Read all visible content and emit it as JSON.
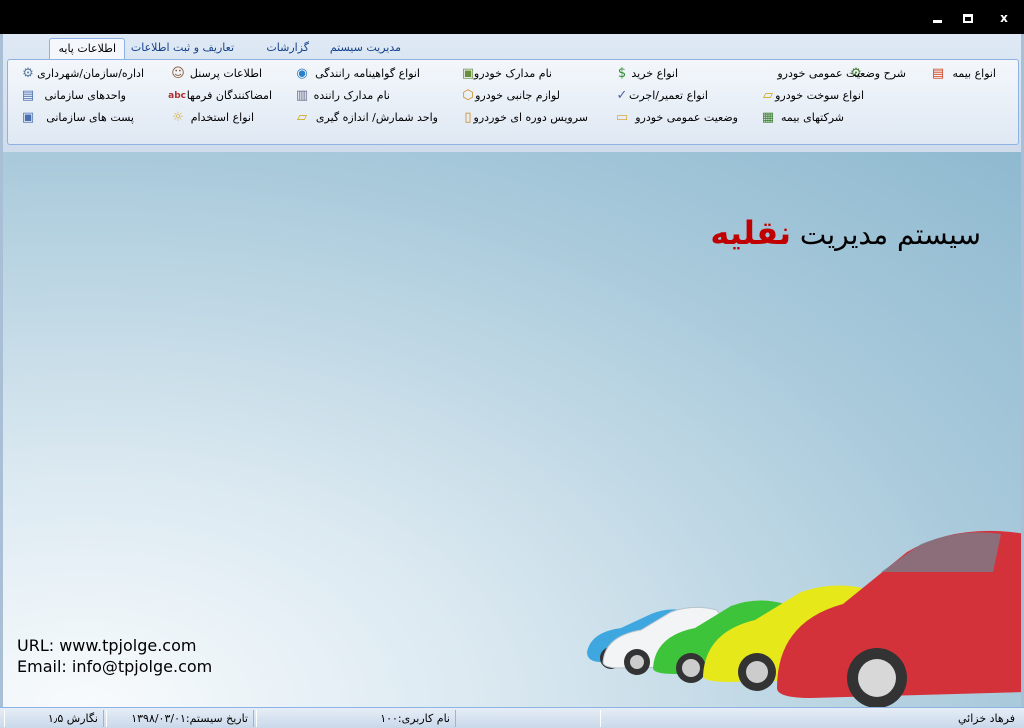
{
  "window": {
    "min_label": "_",
    "max_label": "□",
    "close_label": "x"
  },
  "tabs": [
    {
      "label": "اطلاعات پایه",
      "active": true
    },
    {
      "label": "تعاریف و ثبت اطلاعات",
      "active": false
    },
    {
      "label": "گزارشات",
      "active": false
    },
    {
      "label": "مدیریت سیستم",
      "active": false
    }
  ],
  "ribbon": {
    "col1": [
      {
        "label": "انواع بیمه",
        "icon": "insurance-type-icon"
      },
      {
        "label": "شرح وضعیت عمومی خودرو",
        "icon": "vehicle-status-description-icon"
      },
      {
        "label": "انواع سوخت خودرو",
        "icon": "fuel-type-icon"
      },
      {
        "label": "شرکتهای بیمه",
        "icon": "insurance-company-icon"
      }
    ],
    "col2": [
      {
        "label": "انواع خرید",
        "icon": "purchase-type-icon"
      },
      {
        "label": "انواع تعمیر/اجرت",
        "icon": "repair-type-icon"
      },
      {
        "label": "وضعیت عمومی خودرو",
        "icon": "vehicle-status-icon"
      }
    ],
    "col3": [
      {
        "label": "نام مدارک خودرو",
        "icon": "vehicle-documents-icon"
      },
      {
        "label": "لوازم جانبی خودرو",
        "icon": "vehicle-accessories-icon"
      },
      {
        "label": "سرویس دوره ای خوردرو",
        "icon": "periodic-service-icon"
      }
    ],
    "col4": [
      {
        "label": "انواع گواهینامه رانندگی",
        "icon": "license-type-icon"
      },
      {
        "label": "نام مدارک راننده",
        "icon": "driver-documents-icon"
      },
      {
        "label": "واحد شمارش/ اندازه گیری",
        "icon": "measurement-unit-icon"
      }
    ],
    "col5": [
      {
        "label": "اطلاعات پرسنل",
        "icon": "personnel-icon"
      },
      {
        "label": "امضاکنندگان فرمها",
        "icon": "form-signers-icon"
      },
      {
        "label": "انواع استخدام",
        "icon": "employment-type-icon"
      }
    ],
    "col6": [
      {
        "label": "اداره/سازمان/شهرداری",
        "icon": "organization-icon"
      },
      {
        "label": "واحدهای سازمانی",
        "icon": "org-units-icon"
      },
      {
        "label": "پست های سازمانی",
        "icon": "org-posts-icon"
      }
    ]
  },
  "main": {
    "title_prefix": "سیستم مدیریت",
    "title_accent": "نقلیه",
    "url_line": "URL: www.tpjolge.com",
    "email_line": "Email: info@tpjolge.com"
  },
  "status": {
    "user_full_name": "فرهاد خزائي",
    "username": "نام کاربری:۱۰۰",
    "system_date": "تاریخ سیستم:۱۳۹۸/۰۳/۰۱",
    "version": "نگارش ۱٫۵"
  },
  "colors": {
    "accent_red": "#c00000",
    "tab_text": "#15428b",
    "ribbon_border": "#8db2e3"
  }
}
